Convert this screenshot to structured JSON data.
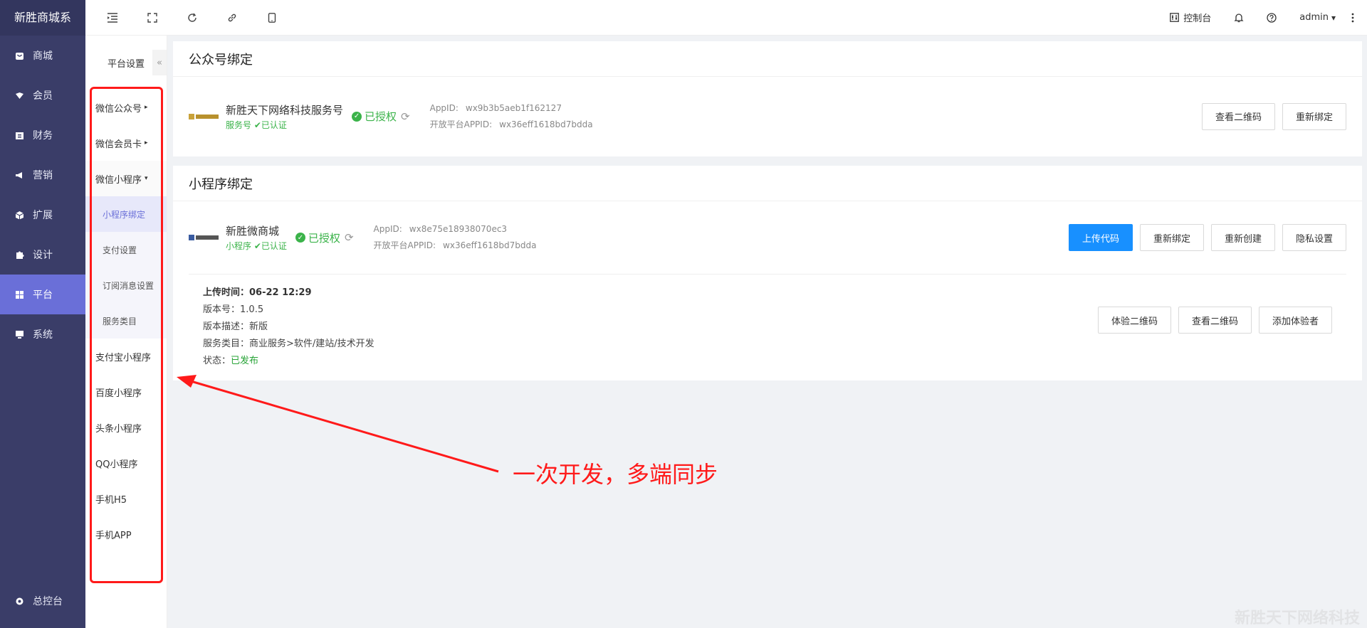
{
  "brand": "新胜商城系",
  "main_nav": [
    {
      "label": "商城",
      "icon": "shop-icon"
    },
    {
      "label": "会员",
      "icon": "member-icon"
    },
    {
      "label": "财务",
      "icon": "finance-icon"
    },
    {
      "label": "营销",
      "icon": "megaphone-icon"
    },
    {
      "label": "扩展",
      "icon": "cube-icon"
    },
    {
      "label": "设计",
      "icon": "puzzle-icon"
    },
    {
      "label": "平台",
      "icon": "grid-icon",
      "active": true
    },
    {
      "label": "系统",
      "icon": "monitor-icon"
    }
  ],
  "main_nav_bottom": {
    "label": "总控台",
    "icon": "gear-icon"
  },
  "subnav": {
    "title": "平台设置",
    "collapse": "«",
    "items": [
      {
        "label": "微信公众号",
        "caret": "▸"
      },
      {
        "label": "微信会员卡",
        "caret": "▸"
      },
      {
        "label": "微信小程序",
        "caret": "▾"
      }
    ],
    "children": [
      "小程序绑定",
      "支付设置",
      "订阅消息设置",
      "服务类目"
    ],
    "others": [
      "支付宝小程序",
      "百度小程序",
      "头条小程序",
      "QQ小程序",
      "手机H5",
      "手机APP"
    ]
  },
  "topbar": {
    "console": "控制台",
    "user": "admin",
    "user_caret": "▾"
  },
  "public_account": {
    "section_title": "公众号绑定",
    "name": "新胜天下网络科技服务号",
    "type": "服务号",
    "verified": "已认证",
    "authorized": "已授权",
    "appid_label": "AppID:",
    "appid": "wx9b3b5aeb1f162127",
    "open_label": "开放平台APPID:",
    "open_appid": "wx36eff1618bd7bdda",
    "buttons": [
      "查看二维码",
      "重新绑定"
    ]
  },
  "mini_program": {
    "section_title": "小程序绑定",
    "name": "新胜微商城",
    "type": "小程序",
    "verified": "已认证",
    "authorized": "已授权",
    "appid_label": "AppID:",
    "appid": "wx8e75e18938070ec3",
    "open_label": "开放平台APPID:",
    "open_appid": "wx36eff1618bd7bdda",
    "buttons": [
      "上传代码",
      "重新绑定",
      "重新创建",
      "隐私设置"
    ],
    "upload_time_label": "上传时间：",
    "upload_time": "06-22 12:29",
    "version_label": "版本号：",
    "version": "1.0.5",
    "desc_label": "版本描述：",
    "desc": "新版",
    "category_label": "服务类目：",
    "category": "商业服务>软件/建站/技术开发",
    "status_label": "状态：",
    "status": "已发布",
    "detail_buttons": [
      "体验二维码",
      "查看二维码",
      "添加体验者"
    ]
  },
  "annotation": "一次开发，多端同步",
  "watermark": "新胜天下网络科技",
  "colors": {
    "sidebar": "#3a3d68",
    "active": "#6a6fd8",
    "primary": "#1890ff",
    "success": "#3bb34a",
    "annotation": "#ff1a1a"
  }
}
